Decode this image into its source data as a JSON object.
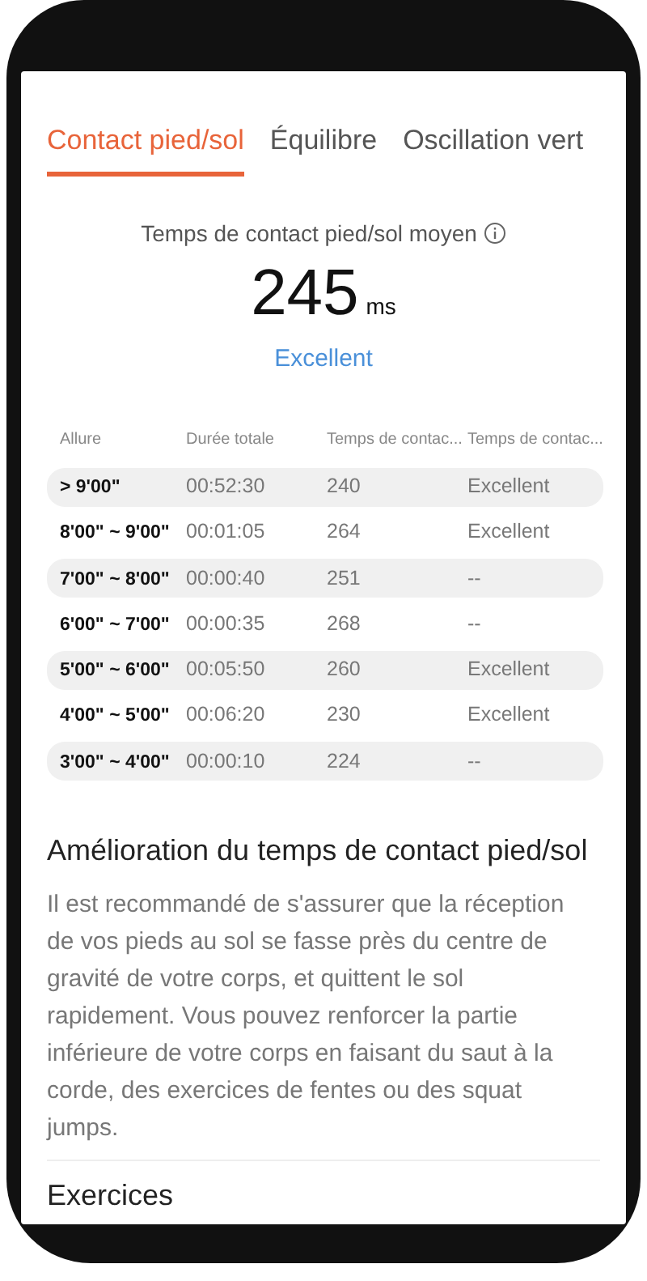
{
  "tabs": [
    {
      "label": "Contact pied/sol",
      "selected": true
    },
    {
      "label": "Équilibre",
      "selected": false
    },
    {
      "label": "Oscillation vert",
      "selected": false
    }
  ],
  "summary": {
    "title": "Temps de contact pied/sol moyen",
    "value": "245",
    "unit": "ms",
    "rating": "Excellent"
  },
  "table": {
    "columns": [
      "Allure",
      "Durée totale",
      "Temps de contac...",
      "Temps de contac..."
    ],
    "rows": [
      [
        "> 9'00\"",
        "00:52:30",
        "240",
        "Excellent"
      ],
      [
        "8'00\" ~ 9'00\"",
        "00:01:05",
        "264",
        "Excellent"
      ],
      [
        "7'00\" ~ 8'00\"",
        "00:00:40",
        "251",
        "--"
      ],
      [
        "6'00\" ~ 7'00\"",
        "00:00:35",
        "268",
        "--"
      ],
      [
        "5'00\" ~ 6'00\"",
        "00:05:50",
        "260",
        "Excellent"
      ],
      [
        "4'00\" ~ 5'00\"",
        "00:06:20",
        "230",
        "Excellent"
      ],
      [
        "3'00\" ~ 4'00\"",
        "00:00:10",
        "224",
        "--"
      ]
    ]
  },
  "advice": {
    "title": "Amélioration du temps de contact pied/sol",
    "text": "Il est recommandé de s'assurer que la réception de vos pieds au sol se fasse près du centre de gravité de votre corps, et quittent le sol rapidement. Vous pouvez renforcer la partie inférieure de votre corps en faisant du saut à la corde, des exercices de fentes ou des squat jumps."
  },
  "next_section": {
    "title": "Exercices"
  }
}
